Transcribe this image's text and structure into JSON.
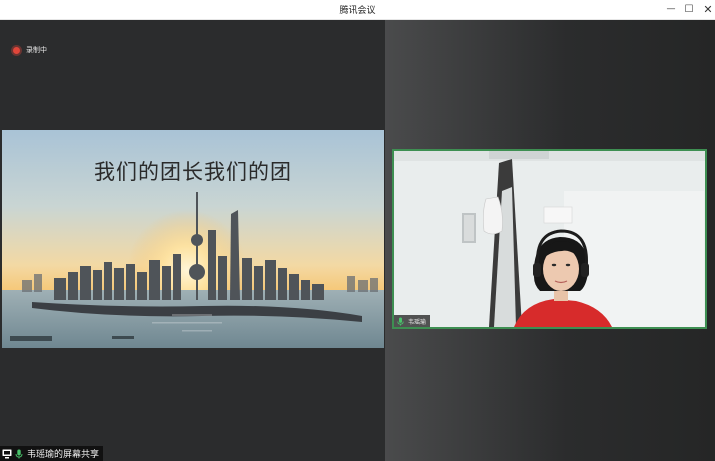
{
  "window": {
    "title": "腾讯会议",
    "controls": {
      "minimize": "—",
      "maximize": "☐",
      "close": "✕"
    }
  },
  "recording": {
    "label": "录制中",
    "icon": "recording-dot-icon",
    "color": "#e0463a"
  },
  "screen_share": {
    "slide_title": "我们的团长我们的团",
    "sharer_label": "韦瑶瑜的屏幕共享",
    "icons": [
      "screen-share-icon",
      "microphone-icon"
    ]
  },
  "participant": {
    "name": "韦瑶瑜",
    "mic_icon": "microphone-icon",
    "tile_border_color": "#3e8f52"
  }
}
